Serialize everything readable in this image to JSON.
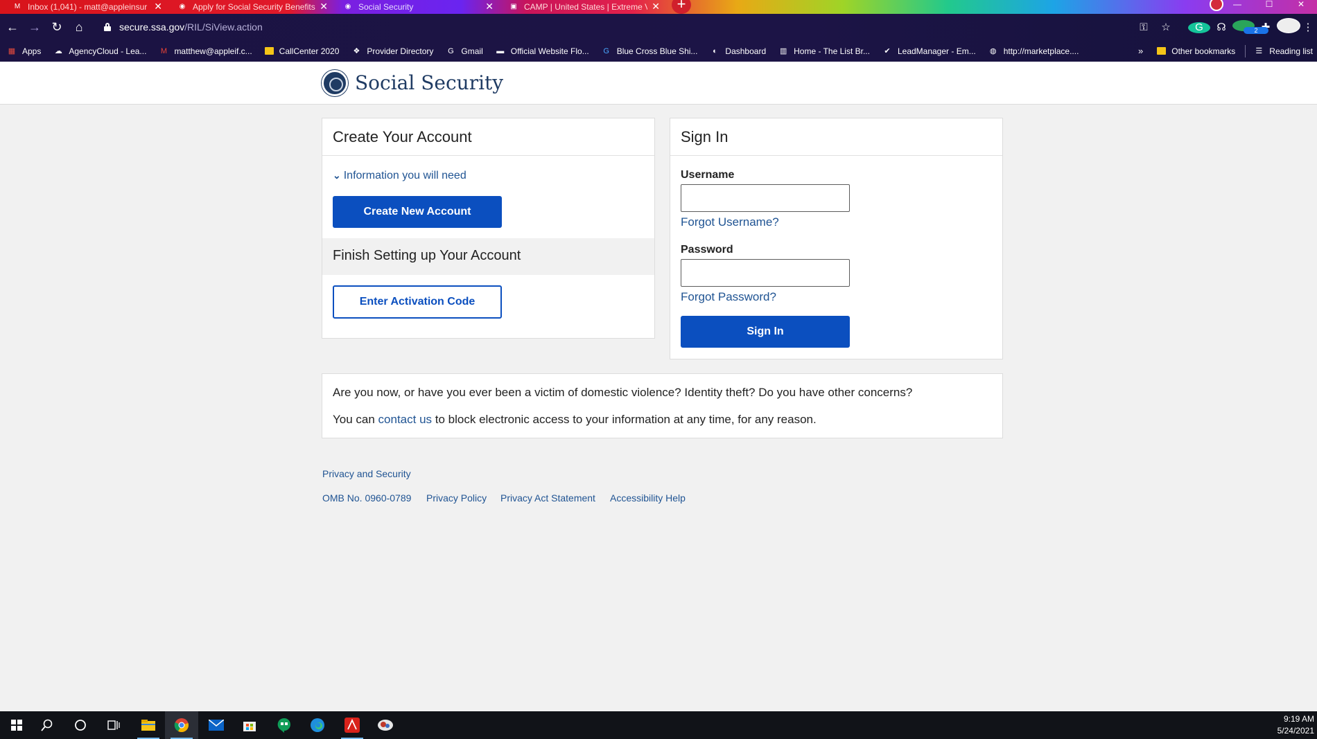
{
  "browser": {
    "tabs": [
      {
        "title": "Inbox (1,041) - matt@appleinsur",
        "favicon": "gmail-icon"
      },
      {
        "title": "Apply for Social Security Benefits",
        "favicon": "ssa-icon"
      },
      {
        "title": "Social Security",
        "favicon": "ssa-icon",
        "active": true
      },
      {
        "title": "CAMP | United States | Extreme V",
        "favicon": "camp-icon"
      }
    ],
    "url_host": "secure.ssa.gov",
    "url_path": "/RIL/SiView.action",
    "extension_badge": "2",
    "bookmarks": [
      {
        "label": "Apps",
        "icon": "apps-grid-icon"
      },
      {
        "label": "AgencyCloud - Lea...",
        "icon": "cloud-icon"
      },
      {
        "label": "matthew@appleif.c...",
        "icon": "gmail-icon"
      },
      {
        "label": "CallCenter 2020",
        "icon": "folder-icon"
      },
      {
        "label": "Provider Directory",
        "icon": "directory-icon"
      },
      {
        "label": "Gmail",
        "icon": "google-icon"
      },
      {
        "label": "Official Website Flo...",
        "icon": "website-icon"
      },
      {
        "label": "Blue Cross Blue Shi...",
        "icon": "bcbs-icon"
      },
      {
        "label": "Dashboard",
        "icon": "dashboard-icon"
      },
      {
        "label": "Home - The List Br...",
        "icon": "list-icon"
      },
      {
        "label": "LeadManager - Em...",
        "icon": "leadmanager-icon"
      },
      {
        "label": "http://marketplace....",
        "icon": "globe-icon"
      }
    ],
    "overflow_label": "»",
    "other_bookmarks": "Other bookmarks",
    "reading_list": "Reading list"
  },
  "header": {
    "brand": "Social Security",
    "logo": "ssa-seal-icon"
  },
  "create_account": {
    "title": "Create Your Account",
    "info_toggle": "Information you will need",
    "create_button": "Create New Account",
    "finish_title": "Finish Setting up Your Account",
    "activation_button": "Enter Activation Code"
  },
  "sign_in": {
    "title": "Sign In",
    "username_label": "Username",
    "username_value": "",
    "forgot_username": "Forgot Username?",
    "password_label": "Password",
    "password_value": "",
    "forgot_password": "Forgot Password?",
    "sign_in_button": "Sign In"
  },
  "notice": {
    "line1": "Are you now, or have you ever been a victim of domestic violence? Identity theft? Do you have other concerns?",
    "line2_before": "You can ",
    "line2_link": "contact us",
    "line2_after": " to block electronic access to your information at any time, for any reason."
  },
  "footer": {
    "privacy_security": "Privacy and Security",
    "omb": "OMB No. 0960-0789",
    "privacy_policy": "Privacy Policy",
    "privacy_act": "Privacy Act Statement",
    "accessibility": "Accessibility Help"
  },
  "taskbar": {
    "time": "9:19 AM",
    "date": "5/24/2021",
    "apps": [
      "windows-start-icon",
      "search-icon",
      "cortana-icon",
      "task-view-icon",
      "file-explorer-icon",
      "chrome-icon",
      "mail-icon",
      "store-icon",
      "hangouts-icon",
      "edge-icon",
      "acrobat-icon",
      "app-icon"
    ]
  },
  "colors": {
    "primary_button": "#0b4fbf",
    "link": "#205493",
    "brand": "#1f3b63"
  }
}
